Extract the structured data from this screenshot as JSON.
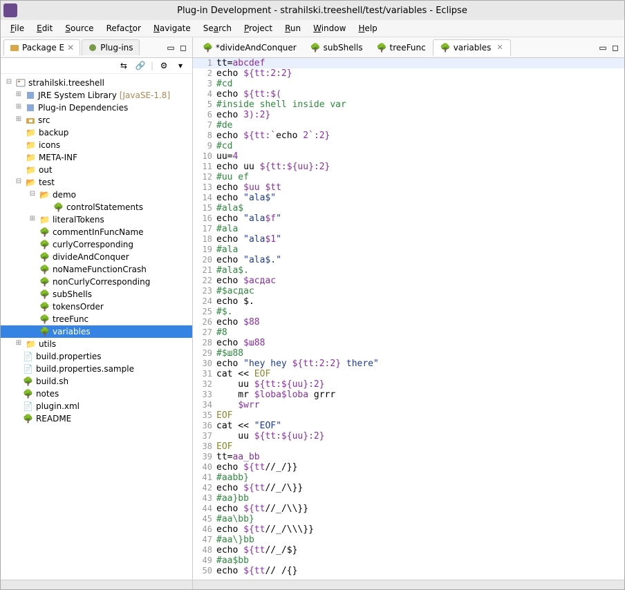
{
  "window": {
    "title": "Plug-in Development - strahilski.treeshell/test/variables - Eclipse"
  },
  "menubar": [
    "File",
    "Edit",
    "Source",
    "Refactor",
    "Navigate",
    "Search",
    "Project",
    "Run",
    "Window",
    "Help"
  ],
  "leftTabs": {
    "active": "Package E",
    "inactive": "Plug-ins"
  },
  "tree": {
    "project": "strahilski.treeshell",
    "jre": "JRE System Library",
    "jreVer": "[JavaSE-1.8]",
    "plugindeps": "Plug-in Dependencies",
    "src": "src",
    "backup": "backup",
    "icons": "icons",
    "metainf": "META-INF",
    "out": "out",
    "test": "test",
    "demo": "demo",
    "controlStatements": "controlStatements",
    "literalTokens": "literalTokens",
    "commentInFuncName": "commentInFuncName",
    "curlyCorresponding": "curlyCorresponding",
    "divideAndConquer": "divideAndConquer",
    "noNameFunctionCrash": "noNameFunctionCrash",
    "nonCurlyCorresponding": "nonCurlyCorresponding",
    "subShells": "subShells",
    "tokensOrder": "tokensOrder",
    "treeFunc": "treeFunc",
    "variables": "variables",
    "utils": "utils",
    "buildprops": "build.properties",
    "buildsample": "build.properties.sample",
    "buildsh": "build.sh",
    "notes": "notes",
    "pluginxml": "plugin.xml",
    "readme": "README"
  },
  "editorTabs": {
    "t1": "*divideAndConquer",
    "t2": "subShells",
    "t3": "treeFunc",
    "t4": "variables"
  },
  "code": {
    "l1a": "tt=",
    "l1b": "abcdef",
    "l2a": "echo ",
    "l2b": "${tt:2:2}",
    "l3": "#cd",
    "l4a": "echo ",
    "l4b": "${tt:$(",
    "l5": "#inside shell inside var",
    "l6a": "echo ",
    "l6b": "3):2}",
    "l7": "#de",
    "l8a": "echo ",
    "l8b": "${tt:`",
    "l8c": "echo ",
    "l8d": "2`:2}",
    "l9": "#cd",
    "l10a": "uu=",
    "l10b": "4",
    "l11a": "echo uu ",
    "l11b": "${tt:${uu}:2}",
    "l12": "#uu ef",
    "l13a": "echo ",
    "l13b": "$uu $tt",
    "l14a": "echo ",
    "l14b": "\"ala$\"",
    "l15": "#ala$",
    "l16a": "echo ",
    "l16b": "\"ala",
    "l16c": "$f",
    "l16d": "\"",
    "l17": "#ala",
    "l18a": "echo ",
    "l18b": "\"ala",
    "l18c": "$1",
    "l18d": "\"",
    "l19": "#ala",
    "l20a": "echo ",
    "l20b": "\"ala$.\"",
    "l21": "#ala$.",
    "l22a": "echo ",
    "l22b": "$асдас",
    "l23": "#$асдас",
    "l24": "echo $.",
    "l25": "#$.",
    "l26a": "echo ",
    "l26b": "$88",
    "l27": "#8",
    "l28a": "echo ",
    "l28b": "$ш88",
    "l29": "#$ш88",
    "l30a": "echo ",
    "l30b": "\"hey hey ",
    "l30c": "${tt:2:2}",
    "l30d": " there\"",
    "l31a": "cat << ",
    "l31b": "EOF",
    "l32a": "    uu ",
    "l32b": "${tt:${uu}:2}",
    "l33a": "    mr ",
    "l33b": "$loba$loba",
    "l33c": " grrr",
    "l34": "    ",
    "l34b": "$wrr",
    "l35": "EOF",
    "l36a": "cat << ",
    "l36b": "\"EOF\"",
    "l37a": "    uu ",
    "l37b": "${tt:${uu}:2}",
    "l38": "EOF",
    "l39a": "tt=",
    "l39b": "aa_bb",
    "l40a": "echo ",
    "l40b": "${tt",
    "l40c": "//_/}}",
    "l41": "#aabb}",
    "l42a": "echo ",
    "l42b": "${tt",
    "l42c": "//_/\\}}",
    "l43": "#aa}bb",
    "l44a": "echo ",
    "l44b": "${tt",
    "l44c": "//_/\\\\}}",
    "l45": "#aa\\bb}",
    "l46a": "echo ",
    "l46b": "${tt",
    "l46c": "//_/\\\\\\}}",
    "l47": "#aa\\}bb",
    "l48a": "echo ",
    "l48b": "${tt",
    "l48c": "//_/$}",
    "l49": "#aa$bb",
    "l50a": "echo ",
    "l50b": "${tt",
    "l50c": "// /{}"
  }
}
